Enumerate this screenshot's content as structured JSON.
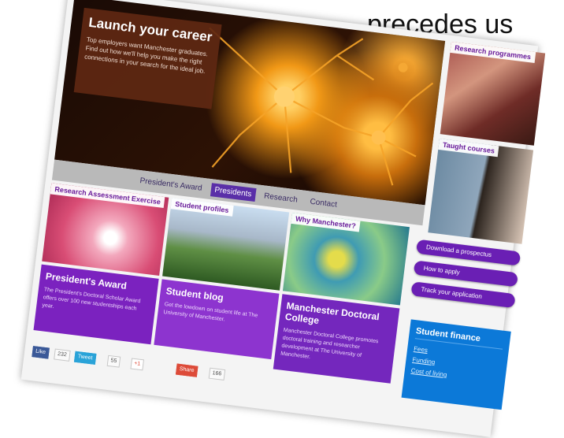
{
  "caption": "precedes us",
  "hero": {
    "title": "Launch your career",
    "text": "Top employers want Manchester graduates. Find out how we'll help you make the right connections in your search for the ideal job."
  },
  "hero_nav": [
    "President's Award",
    "Presidents",
    "Research",
    "Contact"
  ],
  "side_cards": {
    "research": "Research programmes",
    "taught": "Taught courses"
  },
  "tiles": {
    "ra": "Research Assessment Exercise",
    "student_profiles": "Student profiles",
    "why_manchester": "Why Manchester?"
  },
  "panels": {
    "presidents_award": {
      "title": "President's Award",
      "text": "The President's Doctoral Scholar Award offers over 100 new studentships each year."
    },
    "student_blog": {
      "title": "Student blog",
      "text": "Get the lowdown on student life at The University of Manchester."
    },
    "manchester_doctoral_college": {
      "title": "Manchester Doctoral College",
      "text": "Manchester Doctoral College promotes doctoral training and researcher development at The University of Manchester."
    }
  },
  "pills": [
    "Download a prospectus",
    "How to apply",
    "Track your application"
  ],
  "student_finance": {
    "title": "Student finance",
    "links": [
      "Fees",
      "Funding",
      "Cost of living"
    ]
  },
  "share": {
    "facebook": "Like",
    "fb_count": "232",
    "tweet": "Tweet",
    "tweet_count": "55",
    "plus": "+1",
    "share_btn": "Share",
    "share_count": "166"
  }
}
